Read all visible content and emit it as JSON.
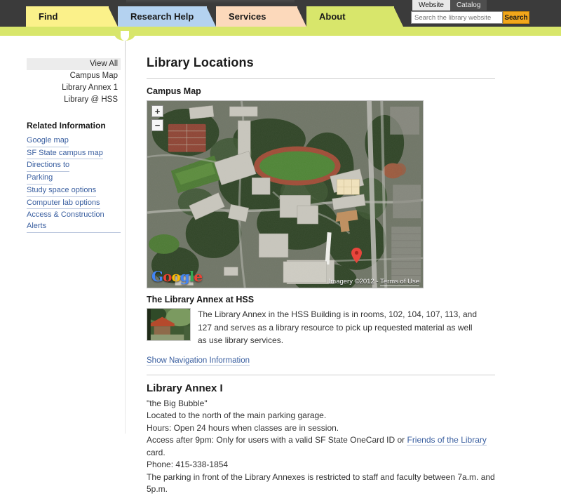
{
  "header": {
    "nav_tabs": [
      {
        "label": "Find",
        "color": "#fbf18a",
        "active": false
      },
      {
        "label": "Research Help",
        "color": "#b4d2f0",
        "active": false
      },
      {
        "label": "Services",
        "color": "#fcd9bb",
        "active": false
      },
      {
        "label": "About",
        "color": "#d8e66b",
        "active": true
      }
    ],
    "search": {
      "scope_tabs": [
        {
          "label": "Website",
          "active": true
        },
        {
          "label": "Catalog",
          "active": false
        }
      ],
      "placeholder": "Search the library website",
      "value": "",
      "button_label": "Search",
      "button_color": "#f2a71b"
    },
    "bar_color": "#d8e66b",
    "topbar_color": "#3b3b3b"
  },
  "sidebar": {
    "items": [
      {
        "label": "View All",
        "active": true
      },
      {
        "label": "Campus Map",
        "active": false
      },
      {
        "label": "Library Annex 1",
        "active": false
      },
      {
        "label": "Library @ HSS",
        "active": false
      }
    ],
    "related_title": "Related Information",
    "related_links": [
      "Google map",
      "SF State campus map",
      "Directions to",
      "Parking",
      "Study space options",
      "Computer lab options",
      "Access & Construction Alerts"
    ]
  },
  "main": {
    "page_title": "Library Locations",
    "campus_map_heading": "Campus Map",
    "map": {
      "zoom_in_label": "+",
      "zoom_out_label": "−",
      "provider_logo": "Google",
      "attribution": "Imagery ©2012",
      "terms_label": "Terms of Use",
      "marker_color": "#e8453c"
    },
    "annex_hss": {
      "title": "The Library Annex at HSS",
      "description": "The Library Annex in the HSS Building is in rooms, 102, 104, 107, 113, and 127 and serves as a library resource to pick up requested material as well as use library services.",
      "nav_link": "Show Navigation Information"
    },
    "annex_one": {
      "title": "Library Annex I",
      "nickname": "\"the Big Bubble\"",
      "location": "Located to the north of the main parking garage.",
      "hours": "Hours: Open 24 hours when classes are in session.",
      "access_prefix": "Access after 9pm: Only for users with a valid SF State OneCard ID or ",
      "access_link": "Friends of the Library",
      "access_suffix": " card.",
      "phone": "Phone: 415-338-1854",
      "parking_note": "The parking in front of the Library Annexes is restricted to staff and faculty between 7a.m. and 5p.m."
    }
  }
}
